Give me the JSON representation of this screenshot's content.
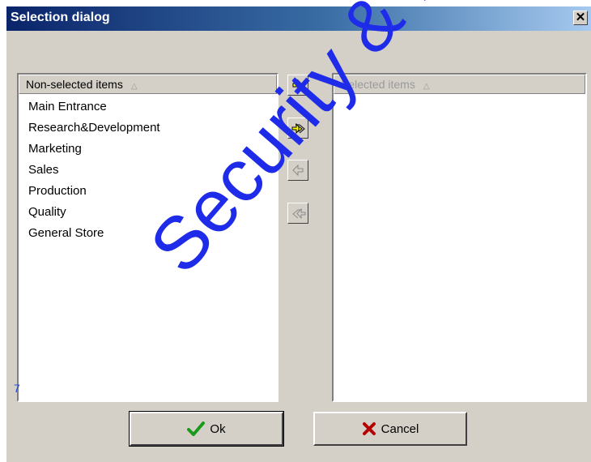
{
  "window": {
    "title": "Selection dialog",
    "close_label": "✕"
  },
  "left_list": {
    "header": "Non-selected items",
    "sort_icon": "triangle-up-icon",
    "items": [
      "Main Entrance",
      "Research&Development",
      "Marketing",
      "Sales",
      "Production",
      "Quality",
      "General Store"
    ]
  },
  "right_list": {
    "header": "Selected items",
    "sort_icon": "triangle-up-icon",
    "items": []
  },
  "transfer_buttons": [
    {
      "icon": "arrow-right-icon",
      "enabled": true
    },
    {
      "icon": "double-arrow-right-icon",
      "enabled": true
    },
    {
      "icon": "arrow-left-icon",
      "enabled": false
    },
    {
      "icon": "double-arrow-left-icon",
      "enabled": false
    }
  ],
  "count": "7",
  "ok_label": "Ok",
  "cancel_label": "Cancel",
  "watermark": "Security & Fire",
  "colors": {
    "title_gradient_start": "#0a246a",
    "title_gradient_end": "#a6caf0",
    "arrow_yellow": "#ffff00",
    "count_blue": "#1d4ed8",
    "ok_check": "#1a9a1a",
    "cancel_x": "#b40000",
    "watermark": "#1e2be8"
  }
}
